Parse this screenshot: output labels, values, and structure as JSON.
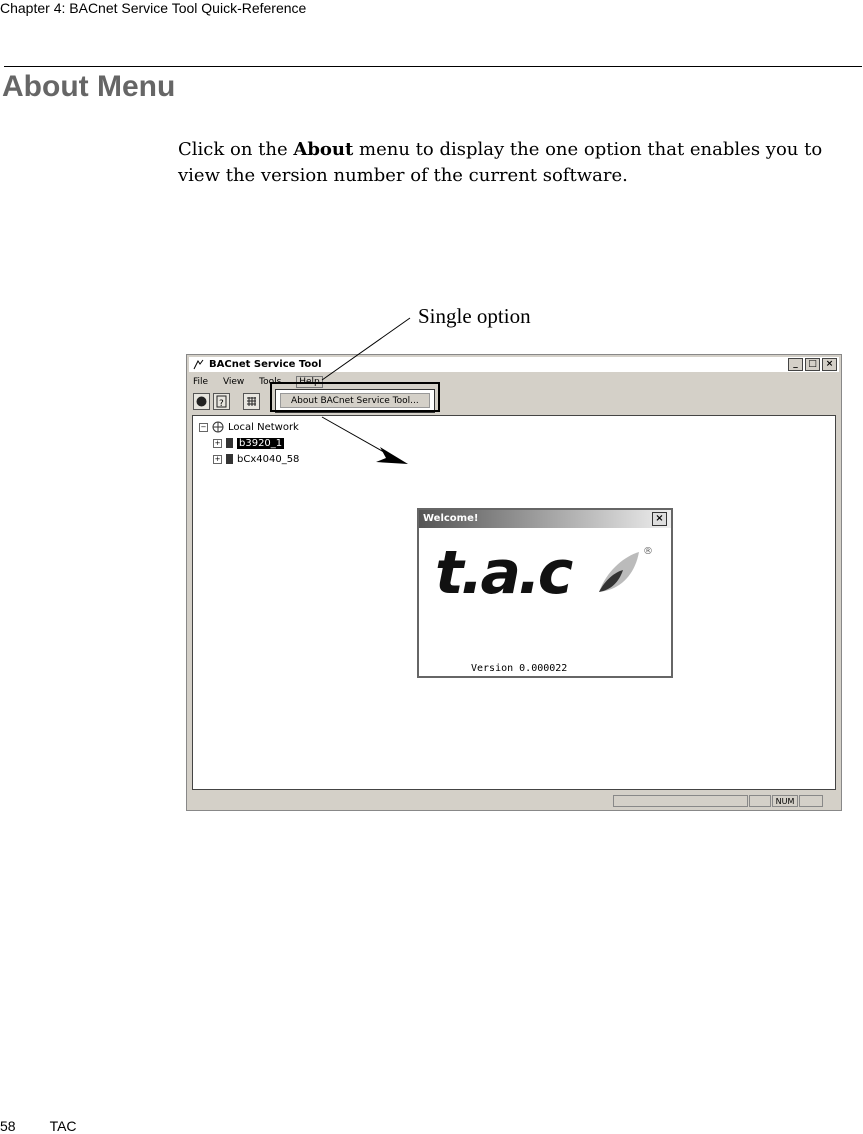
{
  "header": {
    "chapter": "Chapter 4: BACnet Service Tool Quick-Reference"
  },
  "section": {
    "title": "About Menu"
  },
  "intro": {
    "before": "Click on the ",
    "bold": "About",
    "after": " menu to display the one option that enables you to view the version number of the current software."
  },
  "callout": {
    "label": "Single option"
  },
  "app": {
    "title": "BACnet Service Tool",
    "window_buttons": [
      "_",
      "□",
      "×"
    ],
    "menu": [
      "File",
      "View",
      "Tools",
      "Help"
    ],
    "dropdown_item": "About BACnet Service Tool...",
    "tree": {
      "root": "Local Network",
      "devices": [
        "b3920_1",
        "bCx4040_58"
      ]
    },
    "status": {
      "num": "NUM"
    }
  },
  "welcome": {
    "title": "Welcome!",
    "close": "×",
    "logo": "t.a.c",
    "registered": "®",
    "version": "Version 0.000022"
  },
  "footer": {
    "page": "58",
    "brand": "TAC"
  }
}
